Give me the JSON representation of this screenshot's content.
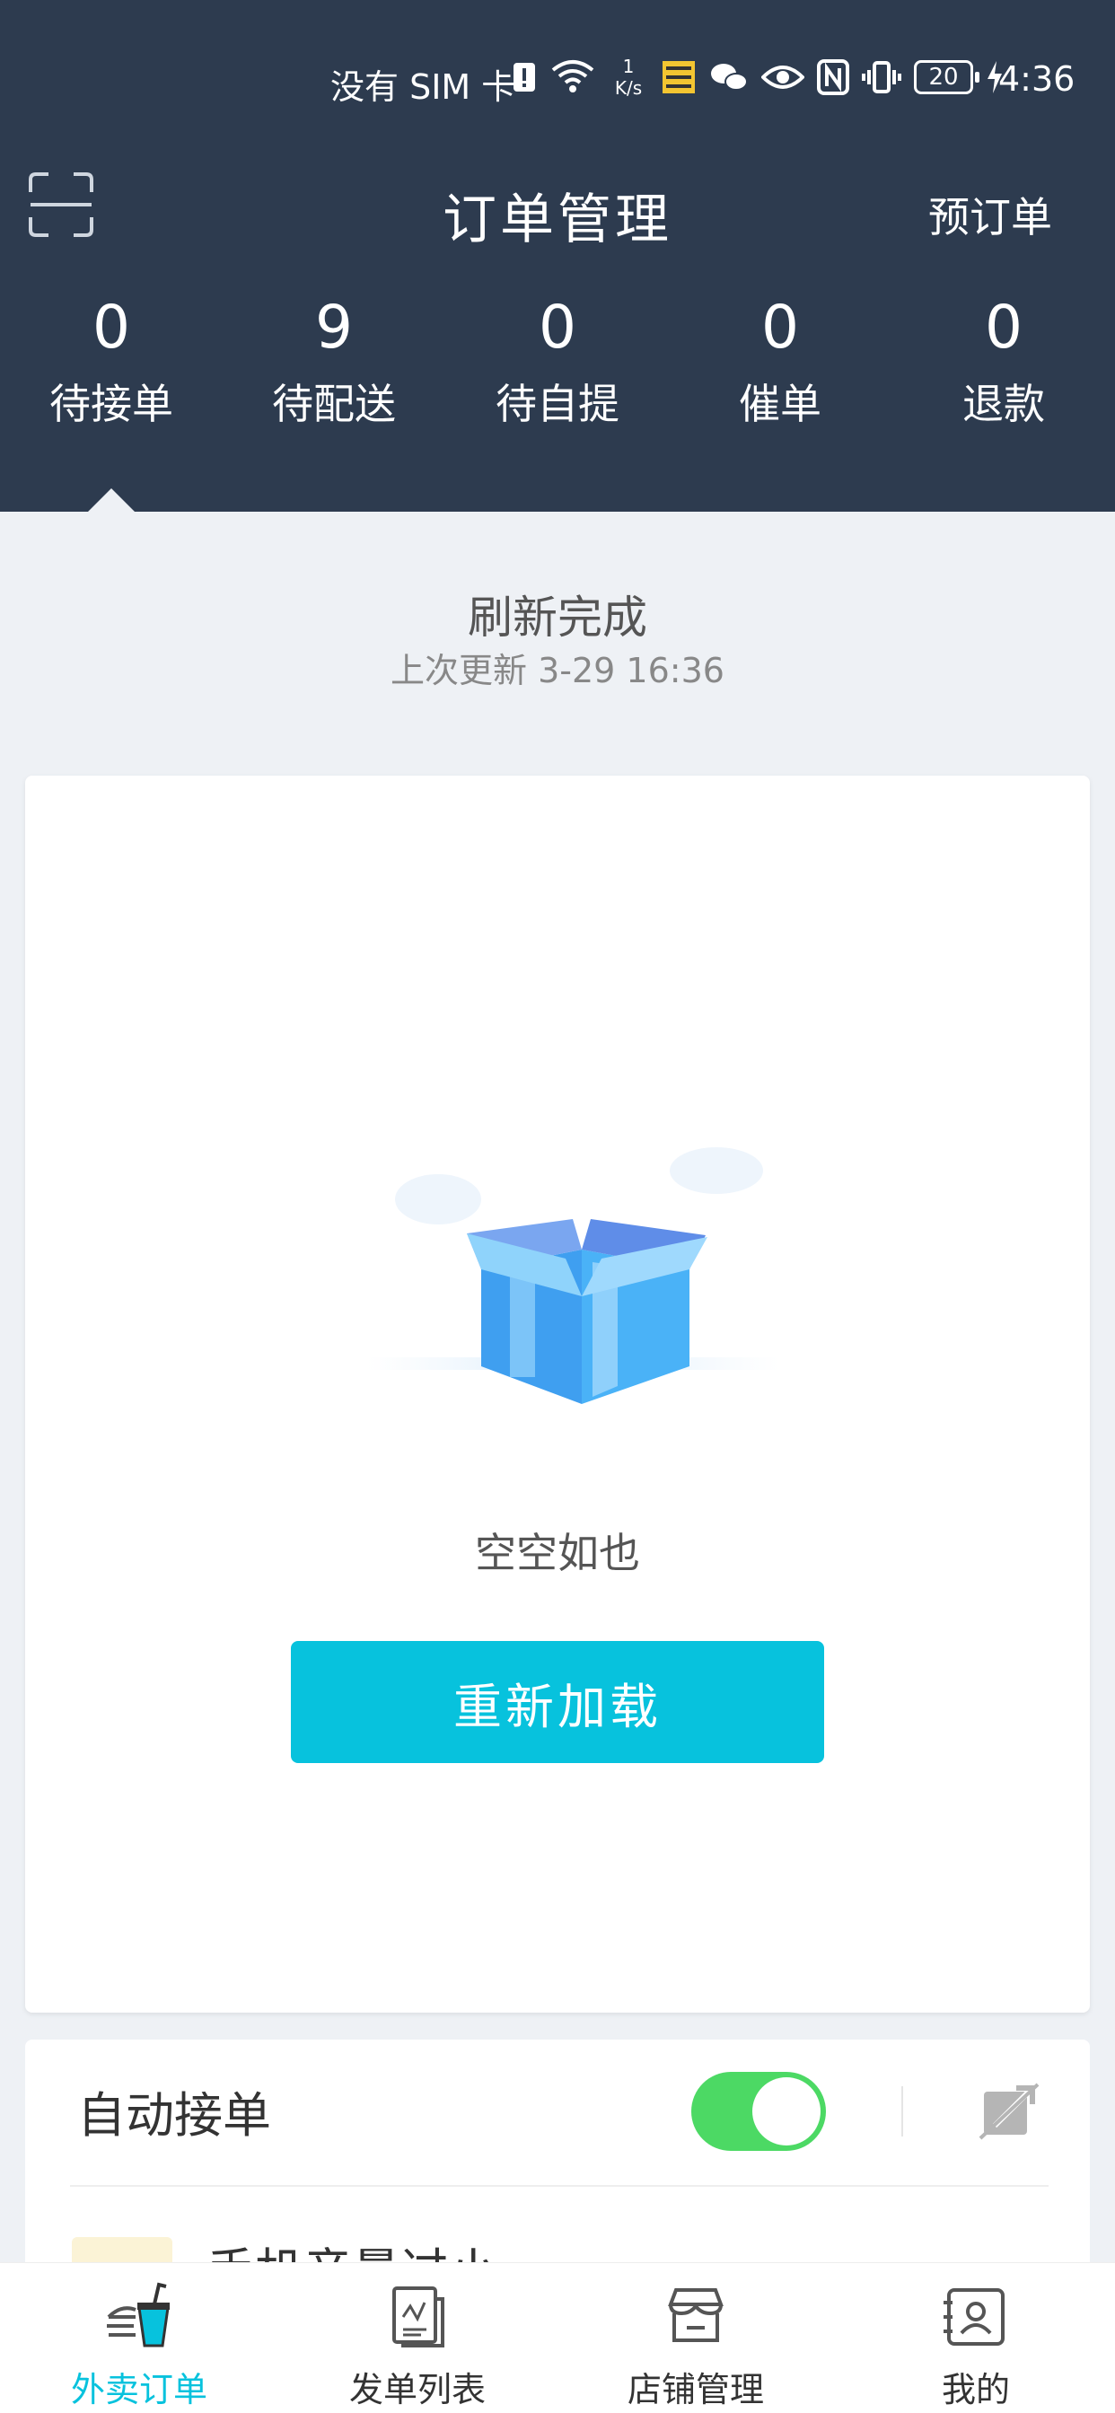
{
  "status_bar": {
    "carrier": "没有 SIM 卡",
    "speed_value": "1",
    "speed_unit": "K/s",
    "battery": "20",
    "time": "4:36"
  },
  "header": {
    "title": "订单管理",
    "preorder_label": "预订单"
  },
  "tabs": [
    {
      "count": "0",
      "label": "待接单"
    },
    {
      "count": "9",
      "label": "待配送"
    },
    {
      "count": "0",
      "label": "待自提"
    },
    {
      "count": "0",
      "label": "催单"
    },
    {
      "count": "0",
      "label": "退款"
    }
  ],
  "refresh": {
    "title": "刷新完成",
    "last_update": "上次更新 3-29 16:36"
  },
  "empty_state": {
    "text": "空空如也",
    "reload_label": "重新加载"
  },
  "auto_accept": {
    "label": "自动接单",
    "enabled": true,
    "warning_text": "手机音量过小"
  },
  "bottom_nav": [
    {
      "label": "外卖订单",
      "icon": "takeout-cup-icon"
    },
    {
      "label": "发单列表",
      "icon": "document-list-icon"
    },
    {
      "label": "店铺管理",
      "icon": "store-icon"
    },
    {
      "label": "我的",
      "icon": "profile-card-icon"
    }
  ],
  "colors": {
    "header_bg": "#2d3b4f",
    "accent": "#07c2dd",
    "toggle_on": "#4cd964",
    "page_bg": "#eef1f5"
  }
}
